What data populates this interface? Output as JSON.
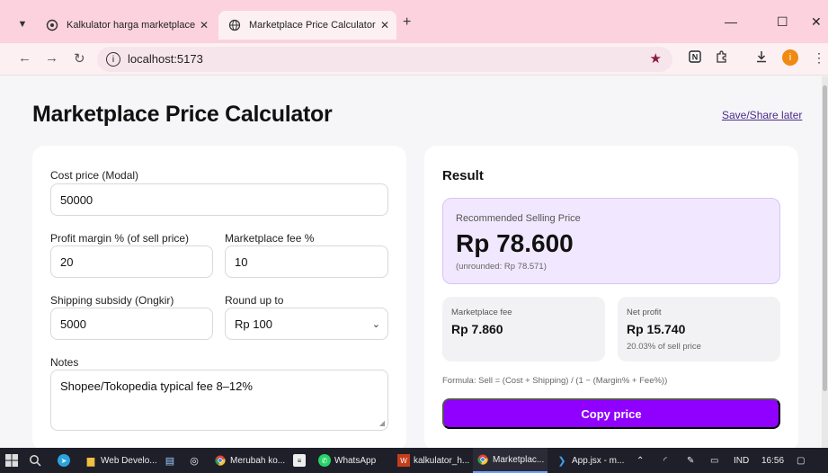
{
  "browser": {
    "tabs": [
      {
        "label": "Kalkulator harga marketplace"
      },
      {
        "label": "Marketplace Price Calculator"
      }
    ],
    "url": "localhost:5173",
    "profile_initial": "i",
    "icons": {
      "menu": "chevron-down-icon",
      "new_tab": "plus-icon",
      "star": "star-icon"
    },
    "accent_color": "#fbd2de"
  },
  "page": {
    "title": "Marketplace Price Calculator",
    "save_link": "Save/Share later"
  },
  "form": {
    "cost_label": "Cost price (Modal)",
    "cost_value": "50000",
    "margin_label": "Profit margin % (of sell price)",
    "margin_value": "20",
    "fee_label": "Marketplace fee %",
    "fee_value": "10",
    "shipping_label": "Shipping subsidy (Ongkir)",
    "shipping_value": "5000",
    "round_label": "Round up to",
    "round_value": "Rp 100",
    "notes_label": "Notes",
    "notes_value": "Shopee/Tokopedia typical fee 8–12%"
  },
  "result": {
    "title": "Result",
    "recommended_label": "Recommended Selling Price",
    "recommended_value": "Rp 78.600",
    "unrounded": "(unrounded: Rp 78.571)",
    "fee_label": "Marketplace fee",
    "fee_value": "Rp 7.860",
    "net_label": "Net profit",
    "net_value": "Rp 15.740",
    "net_sub": "20.03% of sell price",
    "formula": "Formula: Sell = (Cost + Shipping) / (1 − (Margin% + Fee%))",
    "copy_button": "Copy price",
    "accent_color": "#8f00ff"
  },
  "taskbar": {
    "apps": [
      {
        "label": "Web Develo..."
      },
      {
        "label": "Merubah ko..."
      },
      {
        "label": "WhatsApp"
      },
      {
        "label": "kalkulator_h..."
      },
      {
        "label": "Marketplac..."
      },
      {
        "label": "App.jsx - m..."
      }
    ],
    "language": "IND",
    "time": "16:56"
  }
}
